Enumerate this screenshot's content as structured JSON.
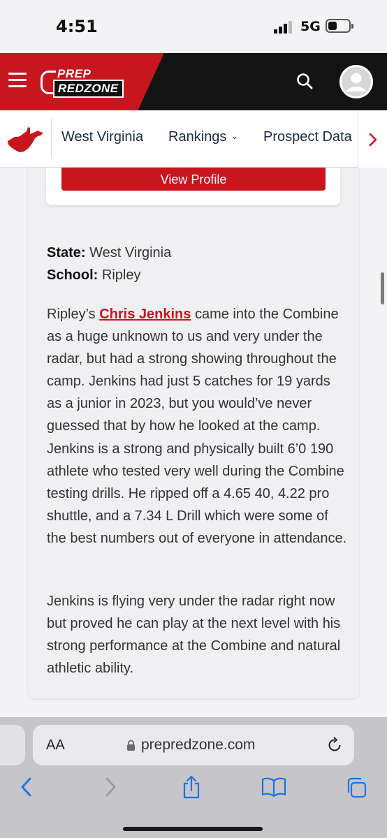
{
  "status": {
    "time": "4:51",
    "network": "5G"
  },
  "header": {
    "logo_top": "PREP",
    "logo_bottom": "REDZONE"
  },
  "subnav": {
    "items": [
      {
        "label": "West Virginia"
      },
      {
        "label": "Rankings"
      },
      {
        "label": "Prospect Data"
      }
    ]
  },
  "profile": {
    "view_button": "View Profile"
  },
  "player": {
    "state_label": "State:",
    "state_value": "West Virginia",
    "school_label": "School:",
    "school_value": "Ripley"
  },
  "article": {
    "p1_prefix": "Ripley’s ",
    "p1_link": "Chris Jenkins",
    "p1_rest": " came into the Combine as a huge unknown to us and very under the radar, but had a strong showing throughout the camp. Jenkins had just 5 catches for 19 yards as a junior in 2023, but you would’ve never guessed that by how he looked at the camp. Jenkins is a strong and physically built 6’0 190 athlete who tested very well during the Combine testing drills. He ripped off a 4.65 40, 4.22 pro shuttle, and a 7.34 L Drill which were some of the best numbers out of everyone in attendance.",
    "p2": "Jenkins is flying very under the radar right now but proved he can play at the next level with his strong performance at the Combine and natural athletic ability."
  },
  "browser": {
    "aa_label": "AA",
    "url": "prepredzone.com"
  },
  "colors": {
    "brand_red": "#c8161e",
    "header_dark": "#141414",
    "nav_text": "#1f2a44",
    "ios_blue": "#1a73e8"
  }
}
